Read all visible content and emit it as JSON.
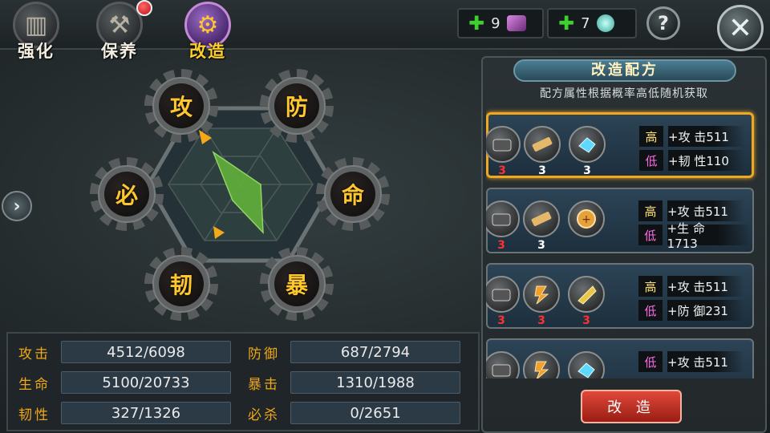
{
  "tabs": [
    {
      "label": "强化",
      "icon": "books-icon",
      "active": false
    },
    {
      "label": "保养",
      "icon": "anvil-icon",
      "active": false,
      "has_notice": true
    },
    {
      "label": "改造",
      "icon": "gear-icon",
      "active": true
    }
  ],
  "currency": [
    {
      "amount": "9",
      "icon": "purple-ore-icon"
    },
    {
      "amount": "7",
      "icon": "cyan-gem-icon"
    }
  ],
  "help_label": "?",
  "close_label": "✕",
  "side_chevron": "›",
  "attributes": {
    "top_left": "攻",
    "top_right": "防",
    "left": "必",
    "right": "命",
    "bottom_left": "韧",
    "bottom_right": "暴"
  },
  "stats": [
    {
      "label": "攻击",
      "value": "4512/6098"
    },
    {
      "label": "防御",
      "value": "687/2794"
    },
    {
      "label": "生命",
      "value": "5100/20733"
    },
    {
      "label": "暴击",
      "value": "1310/1988"
    },
    {
      "label": "韧性",
      "value": "327/1326"
    },
    {
      "label": "必杀",
      "value": "0/2651"
    }
  ],
  "recipe_panel": {
    "title": "改造配方",
    "subtitle": "配方属性根据概率高低随机获取",
    "recipes": [
      {
        "materials": [
          {
            "icon": "iron-ore-icon",
            "count": "3",
            "color": "#ff3030"
          },
          {
            "icon": "wood-plank-icon",
            "count": "3",
            "color": "#ffffff"
          },
          {
            "icon": "blue-crystal-icon",
            "count": "3",
            "color": "#ffffff"
          }
        ],
        "high": {
          "tag": "高",
          "text": "+攻 击511"
        },
        "low": {
          "tag": "低",
          "text": "+韧 性110"
        },
        "selected": true
      },
      {
        "materials": [
          {
            "icon": "iron-ore-icon",
            "count": "3",
            "color": "#ff3030"
          },
          {
            "icon": "wood-plank-icon",
            "count": "3",
            "color": "#ffffff"
          },
          {
            "icon": "gold-medal-icon",
            "count": "",
            "color": "#ffffff"
          }
        ],
        "high": {
          "tag": "高",
          "text": "+攻 击511"
        },
        "low": {
          "tag": "低",
          "text": "+生 命1713"
        },
        "selected": false
      },
      {
        "materials": [
          {
            "icon": "iron-ore-icon",
            "count": "3",
            "color": "#ff3030"
          },
          {
            "icon": "fire-bolt-icon",
            "count": "3",
            "color": "#ff3030"
          },
          {
            "icon": "gold-cone-icon",
            "count": "3",
            "color": "#ff3030"
          }
        ],
        "high": {
          "tag": "高",
          "text": "+攻 击511"
        },
        "low": {
          "tag": "低",
          "text": "+防 御231"
        },
        "selected": false
      },
      {
        "materials": [
          {
            "icon": "iron-ore-icon",
            "count": "",
            "color": "#ff3030"
          },
          {
            "icon": "fire-bolt-icon",
            "count": "",
            "color": "#ff3030"
          },
          {
            "icon": "blue-crystal-icon",
            "count": "",
            "color": "#ffffff"
          }
        ],
        "high": {
          "tag": "低",
          "text": "+攻 击511"
        },
        "low": {
          "tag": "",
          "text": ""
        },
        "selected": false
      }
    ]
  },
  "forge_button": "改 造"
}
